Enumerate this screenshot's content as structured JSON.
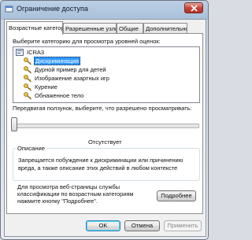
{
  "window": {
    "title": "Ограничение доступа"
  },
  "tabs": [
    {
      "label": "Возрастные категории"
    },
    {
      "label": "Разрешенные узлы"
    },
    {
      "label": "Общие"
    },
    {
      "label": "Дополнительно"
    }
  ],
  "panel": {
    "tree_prompt": "Выберите категорию для просмотра уровней оценок:",
    "tree": {
      "root": "ICRA3",
      "items": [
        {
          "label": "Дискриминация",
          "selected": true
        },
        {
          "label": "Дурной пример для детей"
        },
        {
          "label": "Изображение азартных игр"
        },
        {
          "label": "Курение"
        },
        {
          "label": "Обнаженное тело"
        }
      ]
    },
    "slider_prompt": "Передвигая ползунок, выберите, что разрешено просматривать:",
    "slider_value_label": "Отсутствует",
    "slider_level": 0,
    "description": {
      "title": "Описание",
      "text_line1": "Запрещается побуждение к дискриминации или причинению",
      "text_line2": "вреда, а также описание этих действий в любом контексте"
    },
    "more_info_line1": "Для просмотра веб-страницы службы",
    "more_info_line2": "классификации по возрастным категориям",
    "more_info_line3": "нажмите кнопку \"Подробнее\".",
    "more_button": "Подробнее"
  },
  "footer": {
    "ok": "OK",
    "cancel": "Отмена",
    "apply": "Применить"
  },
  "colors": {
    "selection": "#3399ff",
    "close_button": "#c8453a"
  }
}
